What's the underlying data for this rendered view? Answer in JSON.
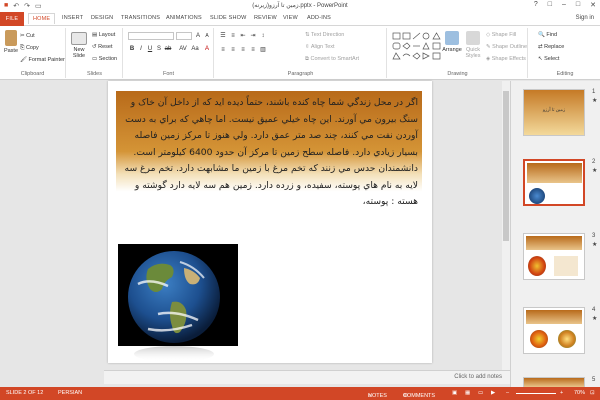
{
  "window": {
    "title": "زمین تا آرزو(زیرنه).pptx - PowerPoint",
    "signin": "Sign in"
  },
  "quick_access": {
    "save_icon": "save-icon",
    "undo_icon": "undo-icon",
    "redo_icon": "redo-icon",
    "start_icon": "start-from-beginning-icon"
  },
  "window_controls": [
    "?",
    "□",
    "–",
    "□",
    "✕"
  ],
  "tabs": {
    "file": "FILE",
    "home": "HOME",
    "insert": "INSERT",
    "design": "DESIGN",
    "transitions": "TRANSITIONS",
    "animations": "ANIMATIONS",
    "slideshow": "SLIDE SHOW",
    "review": "REVIEW",
    "view": "VIEW",
    "addins": "ADD-INS"
  },
  "ribbon": {
    "clipboard": {
      "label": "Clipboard",
      "paste": "Paste",
      "cut": "Cut",
      "copy": "Copy",
      "format_painter": "Format Painter"
    },
    "slides": {
      "label": "Slides",
      "new_slide": "New Slide",
      "layout": "Layout",
      "reset": "Reset",
      "section": "Section"
    },
    "font": {
      "label": "Font"
    },
    "paragraph": {
      "label": "Paragraph",
      "text_direction": "Text Direction",
      "align_text": "Align Text",
      "smartart": "Convert to SmartArt"
    },
    "drawing": {
      "label": "Drawing",
      "arrange": "Arrange",
      "quick_styles": "Quick Styles",
      "shape_fill": "Shape Fill",
      "shape_outline": "Shape Outline",
      "shape_effects": "Shape Effects"
    },
    "editing": {
      "label": "Editing",
      "find": "Find",
      "replace": "Replace",
      "select": "Select"
    }
  },
  "slide": {
    "body_text": "اگر در محل زندگي شما چاه کنده باشند، حتماً ديده ايد که از داخل آن خاک و سنگ بيرون مي آورند. اين چاه خيلي عميق نيست. اما چاهي که براي به دست آوردن نفت مي کنند، چند صد متر عمق دارد. ولي هنوز تا مرکز زمين فاصله بسيار زيادي دارد. فاصله سطح زمين تا مرکز آن حدود 6400 کيلومتر است. دانشمندان حدس مي زنند که تخم مرغ با زمين ما مشابهت دارد. تخم مرغ سه لايه به نام هاي پوسته، سفيده، و زرده دارد. زمين هم سه لايه دارد گوشته و هسته : پوسته،"
  },
  "notes_placeholder": "Click to add notes",
  "thumbnails": [
    {
      "num": "1",
      "star": "★",
      "title": "زمین تا آرزو"
    },
    {
      "num": "2",
      "star": "★"
    },
    {
      "num": "3",
      "star": "★"
    },
    {
      "num": "4",
      "star": "★"
    },
    {
      "num": "5",
      "star": ""
    }
  ],
  "status": {
    "slide_info": "SLIDE 2 OF 12",
    "language": "PERSIAN",
    "notes": "NOTES",
    "comments": "COMMENTS",
    "zoom": "70%"
  },
  "colors": {
    "accent": "#d24726",
    "slide_gradient_top": "#b86a1a"
  }
}
